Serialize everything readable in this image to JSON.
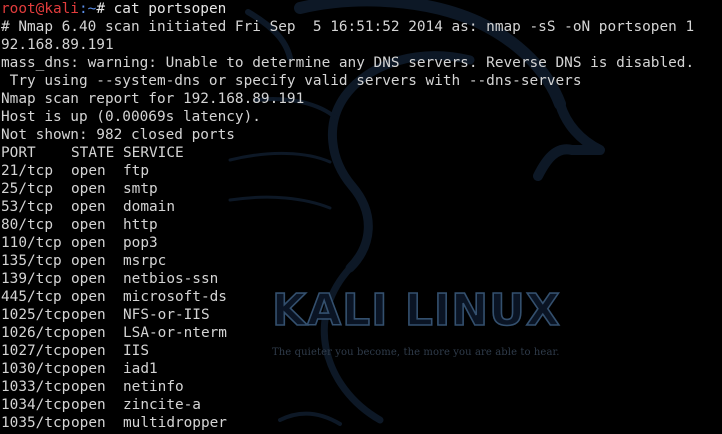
{
  "prompt": {
    "user": "root@kali",
    "path": ":~",
    "symbol": "# ",
    "command": "cat portsopen"
  },
  "output": {
    "header_line_1": "# Nmap 6.40 scan initiated Fri Sep  5 16:51:52 2014 as: nmap -sS -oN portsopen 1",
    "header_line_2": "92.168.89.191",
    "warning_1": "mass_dns: warning: Unable to determine any DNS servers. Reverse DNS is disabled.",
    "warning_2": " Try using --system-dns or specify valid servers with --dns-servers",
    "report": "Nmap scan report for 192.168.89.191",
    "host_up": "Host is up (0.00069s latency).",
    "not_shown": "Not shown: 982 closed ports"
  },
  "table": {
    "headers": {
      "port": "PORT",
      "state": "STATE",
      "service": "SERVICE"
    },
    "rows": [
      {
        "port": "21/tcp",
        "state": "open",
        "service": "ftp"
      },
      {
        "port": "25/tcp",
        "state": "open",
        "service": "smtp"
      },
      {
        "port": "53/tcp",
        "state": "open",
        "service": "domain"
      },
      {
        "port": "80/tcp",
        "state": "open",
        "service": "http"
      },
      {
        "port": "110/tcp",
        "state": "open",
        "service": "pop3"
      },
      {
        "port": "135/tcp",
        "state": "open",
        "service": "msrpc"
      },
      {
        "port": "139/tcp",
        "state": "open",
        "service": "netbios-ssn"
      },
      {
        "port": "445/tcp",
        "state": "open",
        "service": "microsoft-ds"
      },
      {
        "port": "1025/tcp",
        "state": "open",
        "service": "NFS-or-IIS"
      },
      {
        "port": "1026/tcp",
        "state": "open",
        "service": "LSA-or-nterm"
      },
      {
        "port": "1027/tcp",
        "state": "open",
        "service": "IIS"
      },
      {
        "port": "1030/tcp",
        "state": "open",
        "service": "iad1"
      },
      {
        "port": "1033/tcp",
        "state": "open",
        "service": "netinfo"
      },
      {
        "port": "1034/tcp",
        "state": "open",
        "service": "zincite-a"
      },
      {
        "port": "1035/tcp",
        "state": "open",
        "service": "multidropper"
      }
    ]
  },
  "wallpaper": {
    "brand": "KALI LINUX",
    "tagline": "The quieter you become, the more you are able to hear."
  },
  "colors": {
    "background": "#000000",
    "text": "#d4d4d4",
    "prompt_user": "#e23c3c",
    "prompt_path": "#5a8de8"
  }
}
